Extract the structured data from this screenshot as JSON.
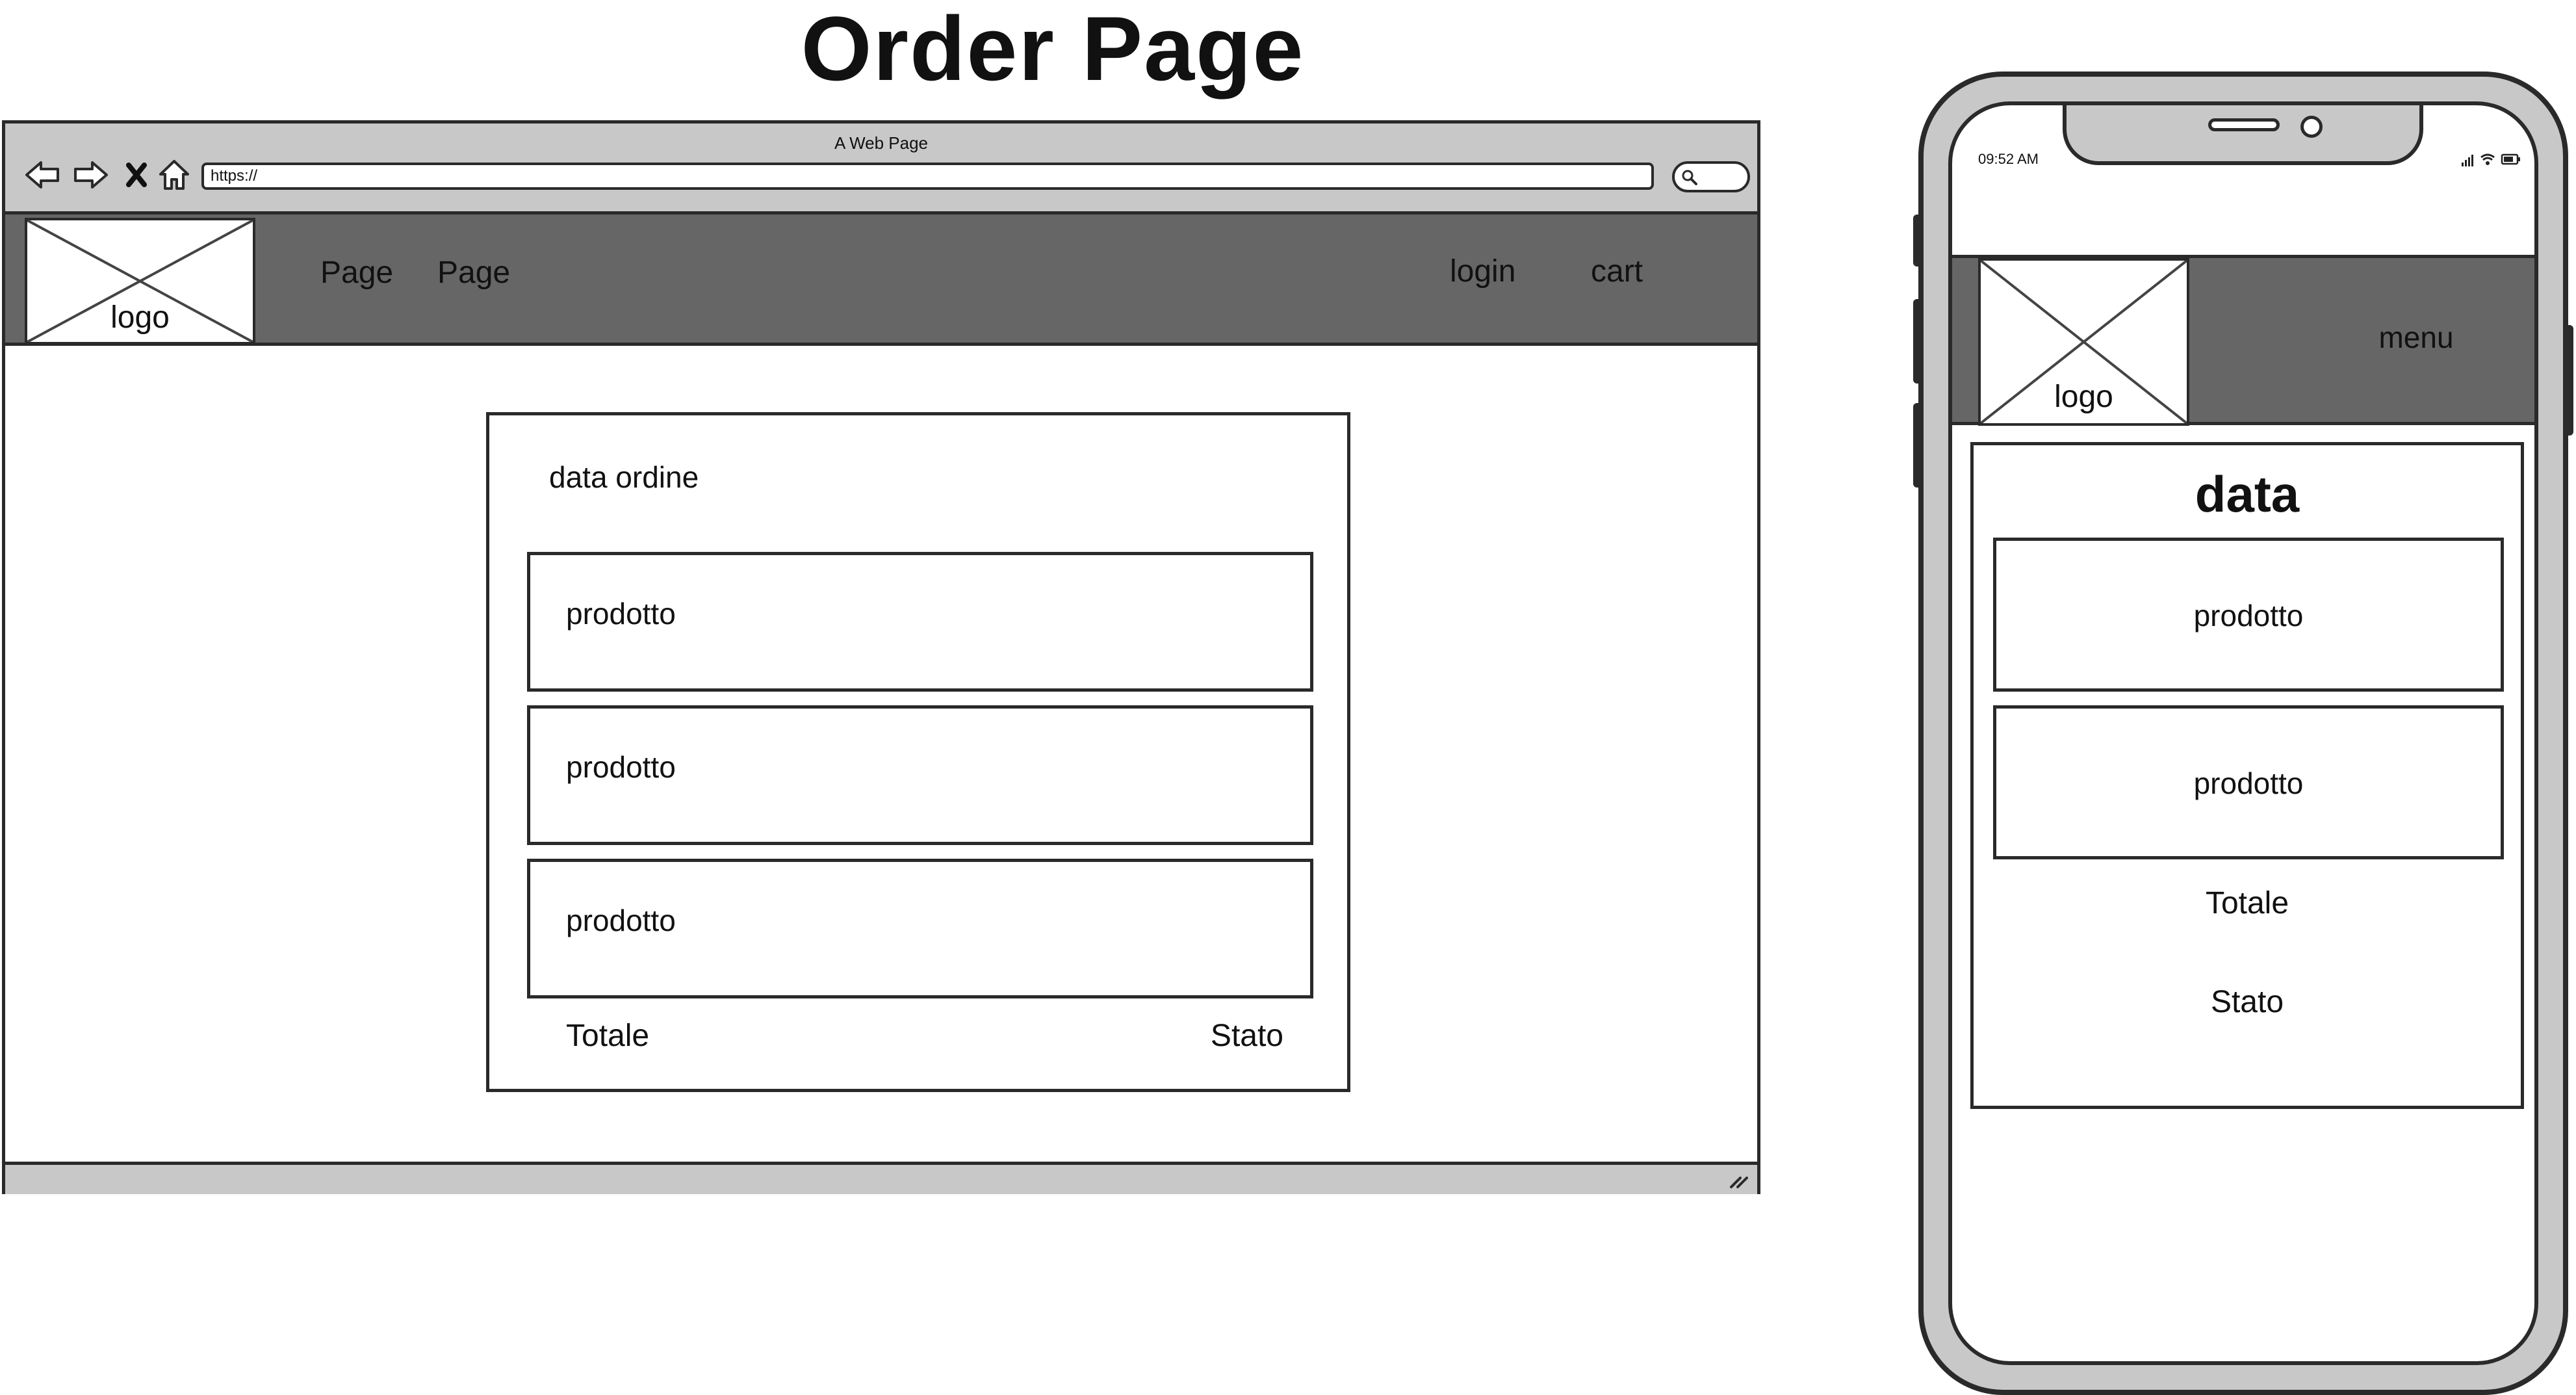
{
  "title": "Order Page",
  "desktop": {
    "window_title": "A Web Page",
    "address": "https://",
    "logo_label": "logo",
    "nav_links": [
      "Page",
      "Page"
    ],
    "login_label": "login",
    "cart_label": "cart",
    "order": {
      "date_label": "data ordine",
      "products": [
        "prodotto",
        "prodotto",
        "prodotto"
      ],
      "total_label": "Totale",
      "status_label": "Stato"
    },
    "icons": {
      "back": "back-arrow-icon",
      "forward": "forward-arrow-icon",
      "stop": "close-icon",
      "home": "home-icon",
      "search": "search-icon",
      "resize": "resize-grip-icon"
    }
  },
  "mobile": {
    "time": "09:52 AM",
    "logo_label": "logo",
    "menu_label": "menu",
    "order": {
      "date_label": "data",
      "products": [
        "prodotto",
        "prodotto"
      ],
      "total_label": "Totale",
      "status_label": "Stato"
    },
    "icons": {
      "signal": "signal-icon",
      "wifi": "wifi-icon",
      "battery": "battery-icon"
    }
  },
  "colors": {
    "header_bg": "#666666",
    "chrome_bg": "#c8c8c8",
    "outline": "#2a2a2a"
  }
}
